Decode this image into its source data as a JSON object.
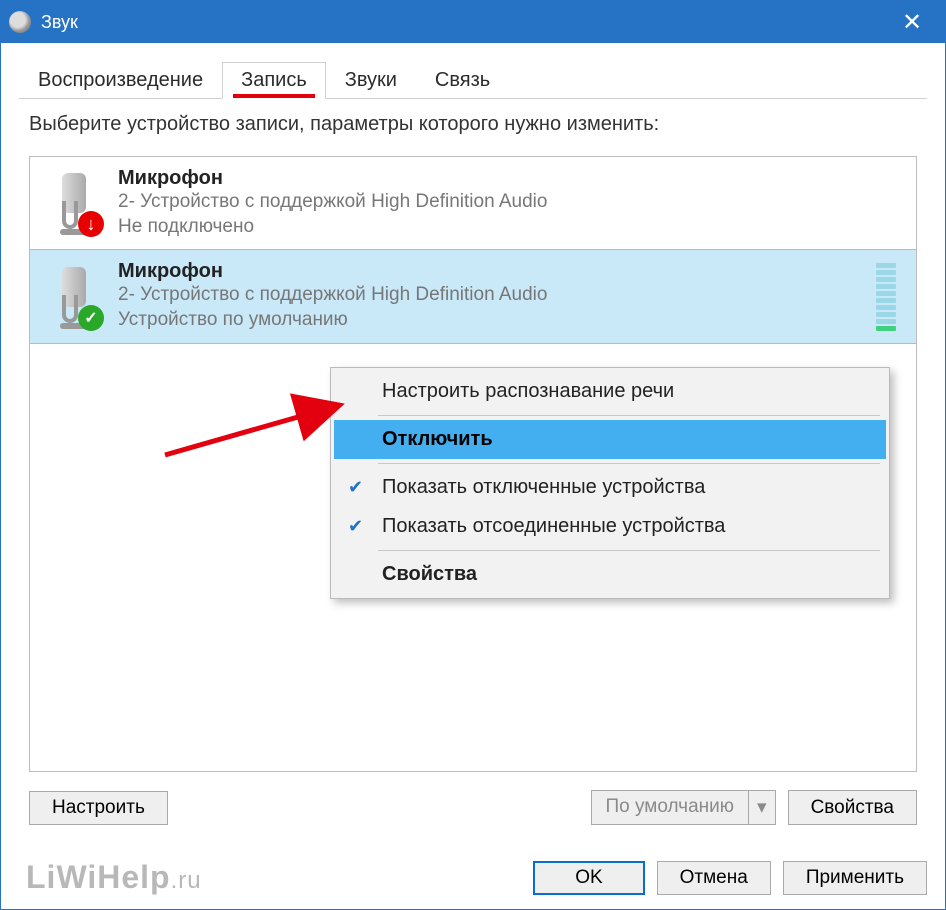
{
  "titlebar": {
    "title": "Звук"
  },
  "tabs": [
    {
      "label": "Воспроизведение"
    },
    {
      "label": "Запись"
    },
    {
      "label": "Звуки"
    },
    {
      "label": "Связь"
    }
  ],
  "instruction": "Выберите устройство записи, параметры которого нужно изменить:",
  "devices": [
    {
      "name": "Микрофон",
      "sub1": "2- Устройство с поддержкой High Definition Audio",
      "sub2": "Не подключено"
    },
    {
      "name": "Микрофон",
      "sub1": "2- Устройство с поддержкой High Definition Audio",
      "sub2": "Устройство по умолчанию"
    }
  ],
  "context_menu": {
    "items": [
      {
        "label": "Настроить распознавание речи"
      },
      {
        "label": "Отключить"
      },
      {
        "label": "Показать отключенные устройства"
      },
      {
        "label": "Показать отсоединенные устройства"
      },
      {
        "label": "Свойства"
      }
    ]
  },
  "buttons": {
    "configure": "Настроить",
    "default": "По умолчанию",
    "properties": "Свойства",
    "ok": "OK",
    "cancel": "Отмена",
    "apply": "Применить"
  },
  "watermark": {
    "main": "LiWiHelp",
    "suffix": ".ru"
  }
}
